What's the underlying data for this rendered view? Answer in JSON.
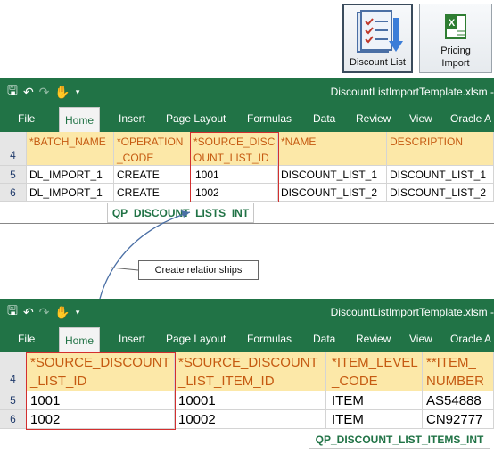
{
  "buttons": {
    "discount_list": "Discount List",
    "pricing_import_line1": "Pricing",
    "pricing_import_line2": "Import"
  },
  "workbook1": {
    "filename": "DiscountListImportTemplate.xlsm -",
    "tabs": [
      "File",
      "Home",
      "Insert",
      "Page Layout",
      "Formulas",
      "Data",
      "Review",
      "View",
      "Oracle A"
    ],
    "active_tab": "Home",
    "header_row_num": "4",
    "headers": [
      {
        "line1": "",
        "line2": "*BATCH_NAME"
      },
      {
        "line1": "*OPERATION",
        "line2": "_CODE"
      },
      {
        "line1": "*SOURCE_DISC",
        "line2": "OUNT_LIST_ID"
      },
      {
        "line1": "",
        "line2": "*NAME"
      },
      {
        "line1": "",
        "line2": "DESCRIPTION"
      }
    ],
    "rows": [
      {
        "num": "5",
        "cells": [
          "DL_IMPORT_1",
          "CREATE",
          "1001",
          "DISCOUNT_LIST_1",
          "DISCOUNT_LIST_1"
        ]
      },
      {
        "num": "6",
        "cells": [
          "DL_IMPORT_1",
          "CREATE",
          "1002",
          "DISCOUNT_LIST_2",
          "DISCOUNT_LIST_2"
        ]
      }
    ],
    "sheet_tab": "QP_DISCOUNT_LISTS_INT"
  },
  "callout": "Create relationships",
  "workbook2": {
    "filename": "DiscountListImportTemplate.xlsm -",
    "tabs": [
      "File",
      "Home",
      "Insert",
      "Page Layout",
      "Formulas",
      "Data",
      "Review",
      "View",
      "Oracle A"
    ],
    "active_tab": "Home",
    "header_row_num": "4",
    "headers": [
      {
        "line1": "*SOURCE_DISCOUNT",
        "line2": "_LIST_ID"
      },
      {
        "line1": "*SOURCE_DISCOUNT",
        "line2": "_LIST_ITEM_ID"
      },
      {
        "line1": "*ITEM_LEVEL",
        "line2": "_CODE"
      },
      {
        "line1": "**ITEM_",
        "line2": "NUMBER"
      }
    ],
    "rows": [
      {
        "num": "5",
        "cells": [
          "1001",
          "10001",
          "ITEM",
          "AS54888"
        ]
      },
      {
        "num": "6",
        "cells": [
          "1002",
          "10002",
          "ITEM",
          "CN92777"
        ]
      }
    ],
    "sheet_tab": "QP_DISCOUNT_LIST_ITEMS_INT"
  }
}
